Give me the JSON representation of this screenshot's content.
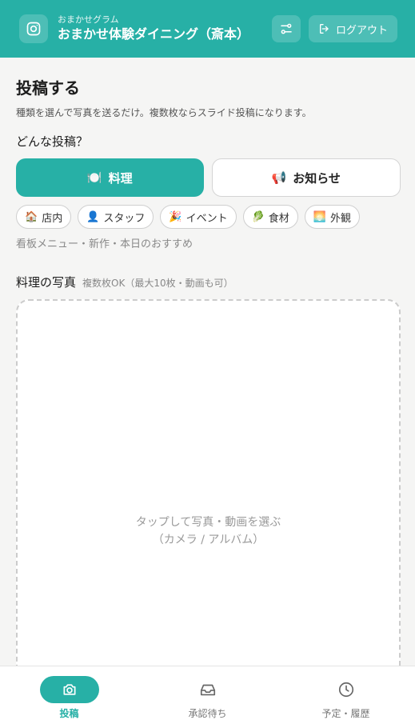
{
  "header": {
    "instagram_icon": "instagram-icon",
    "brand_sub": "おまかせグラム",
    "brand_name": "おまかせ体験ダイニング（斎本）",
    "filter_icon": "sliders-icon",
    "logout_label": "ログアウト",
    "accent": "#27b0a6"
  },
  "main": {
    "title": "投稿する",
    "description": "種類を選んで写真を送るだけ。複数枚ならスライド投稿になります。",
    "question": "どんな投稿？",
    "post_types": [
      {
        "icon": "🍽️",
        "label": "料理",
        "active": true
      },
      {
        "icon": "📢",
        "label": "お知らせ",
        "active": false
      }
    ],
    "categories": [
      {
        "icon": "🏠",
        "label": "店内"
      },
      {
        "icon": "👤",
        "label": "スタッフ"
      },
      {
        "icon": "🎉",
        "label": "イベント"
      },
      {
        "icon": "🥬",
        "label": "食材"
      },
      {
        "icon": "🌅",
        "label": "外観"
      }
    ],
    "hint": "看板メニュー・新作・本日のおすすめ",
    "photo_label": "料理の写真",
    "photo_note": "複数枚OK（最大10枚・動画も可）",
    "dropzone_main": "タップして写真・動画を選ぶ",
    "dropzone_sub": "（カメラ / アルバム）"
  },
  "tabbar": {
    "tabs": [
      {
        "icon": "camera-icon",
        "label": "投稿",
        "active": true
      },
      {
        "icon": "inbox-icon",
        "label": "承認待ち",
        "active": false
      },
      {
        "icon": "clock-icon",
        "label": "予定・履歴",
        "active": false
      }
    ]
  }
}
